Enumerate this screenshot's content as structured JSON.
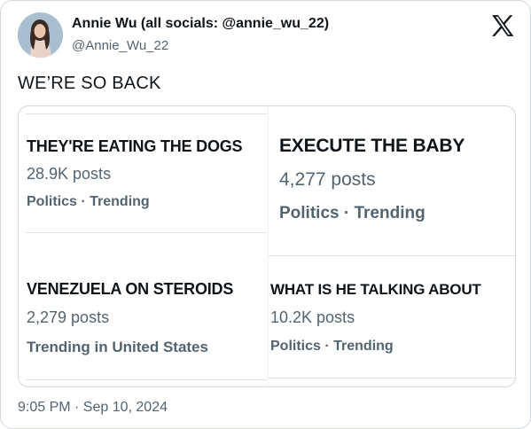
{
  "author": {
    "display_name": "Annie Wu (all socials: @annie_wu_22)",
    "handle": "@Annie_Wu_22"
  },
  "tweet": {
    "text": "WE’RE SO BACK",
    "timestamp": "9:05 PM · Sep 10, 2024"
  },
  "trends": [
    {
      "title": "THEY'RE EATING THE DOGS",
      "count": "28.9K posts",
      "category": "Politics · Trending"
    },
    {
      "title": "EXECUTE THE BABY",
      "count": "4,277 posts",
      "category": "Politics · Trending"
    },
    {
      "title": "VENEZUELA ON STEROIDS",
      "count": "2,279 posts",
      "category": "Trending in United States"
    },
    {
      "title": "WHAT IS HE TALKING ABOUT",
      "count": "10.2K posts",
      "category": "Politics · Trending"
    }
  ],
  "colors": {
    "text": "#0f1419",
    "secondary_text": "#536471",
    "border": "#cfd9de"
  },
  "icons": {
    "platform_logo": "x-logo-icon"
  }
}
